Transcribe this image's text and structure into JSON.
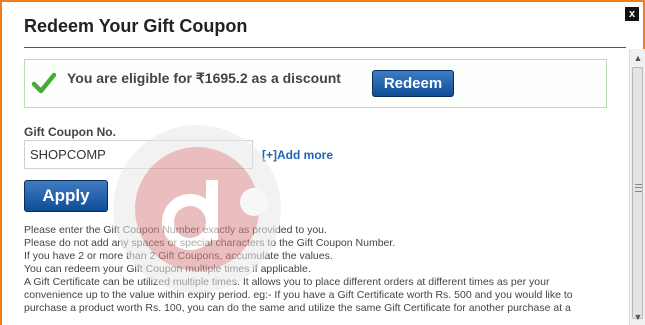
{
  "dialog": {
    "title": "Redeem Your Gift Coupon",
    "close_label": "x"
  },
  "eligibility": {
    "message": "You are eligible for ₹1695.2 as a discount",
    "redeem_label": "Redeem"
  },
  "coupon": {
    "label": "Gift Coupon No.",
    "value": "SHOPCOMP",
    "add_more_label": "[+]Add more",
    "apply_label": "Apply"
  },
  "instructions": [
    "Please enter the Gift Coupon Number exactly as provided to you.",
    "Please do not add any spaces or special characters to the Gift Coupon Number.",
    "If you have 2 or more than 2 Gift Coupons, accumulate the values.",
    "You can redeem your Gift Coupon multiple times if applicable.",
    "A Gift Certificate can be utilized multiple times. It allows you to place different orders at different times as per your",
    "convenience up to the value within expiry period. eg:- If you have a Gift Certificate worth Rs. 500 and you would like to",
    "purchase a product worth Rs. 100, you can do the same and utilize the same Gift Certificate for another purchase at a"
  ],
  "colors": {
    "frame_border": "#f07d1e",
    "button_blue": "#0e4d96",
    "link_blue": "#1f64b5",
    "eligible_border": "#b9dcb0"
  },
  "icons": {
    "check": "check-icon",
    "close": "close-icon",
    "watermark": "watermark-logo-icon"
  }
}
